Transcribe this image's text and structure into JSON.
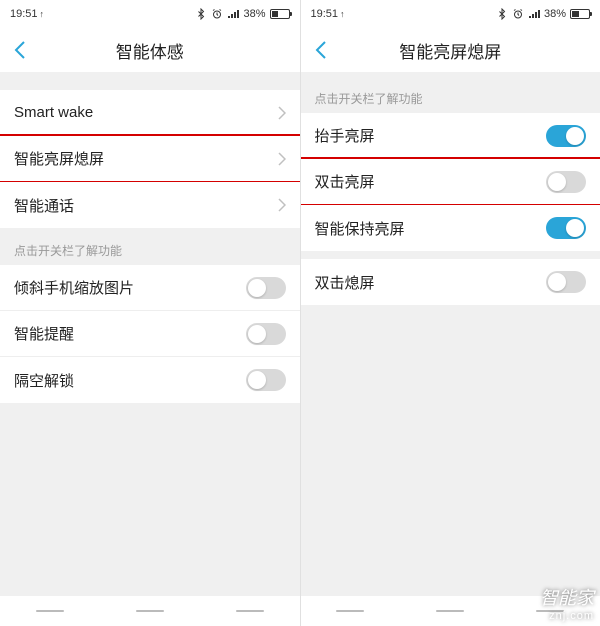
{
  "status": {
    "time": "19:51",
    "battery_pct": "38%",
    "battery_fill": 38
  },
  "left": {
    "title": "智能体感",
    "nav_rows": [
      {
        "label": "Smart wake"
      },
      {
        "label": "智能亮屏熄屏",
        "highlight": true
      },
      {
        "label": "智能通话"
      }
    ],
    "section_label": "点击开关栏了解功能",
    "toggle_rows": [
      {
        "label": "倾斜手机缩放图片",
        "on": false
      },
      {
        "label": "智能提醒",
        "on": false
      },
      {
        "label": "隔空解锁",
        "on": false
      }
    ]
  },
  "right": {
    "title": "智能亮屏熄屏",
    "section_label": "点击开关栏了解功能",
    "group1": [
      {
        "label": "抬手亮屏",
        "on": true
      },
      {
        "label": "双击亮屏",
        "on": false,
        "highlight": true
      },
      {
        "label": "智能保持亮屏",
        "on": true
      }
    ],
    "group2": [
      {
        "label": "双击熄屏",
        "on": false
      }
    ]
  },
  "watermark": {
    "line1": "智能家",
    "line2": "znj.com"
  }
}
